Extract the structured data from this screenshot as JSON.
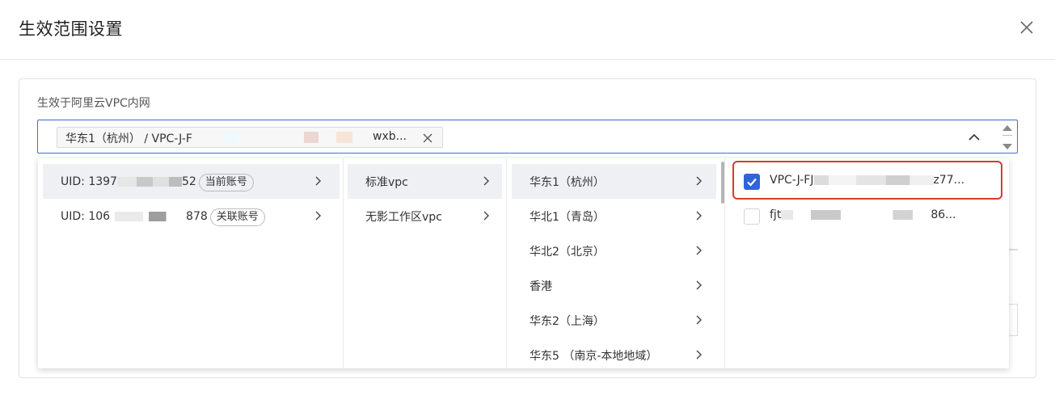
{
  "dialog": {
    "title": "生效范围设置",
    "close_icon": "close-icon"
  },
  "form": {
    "label": "生效于阿里云VPC内网",
    "selected_tag": {
      "text": "华东1（杭州） / VPC-J-F",
      "tail": "wxb..."
    }
  },
  "cascader": {
    "accounts": [
      {
        "uid_prefix": "UID: 1397",
        "uid_suffix": "52",
        "badge": "当前账号",
        "active": true
      },
      {
        "uid_prefix": "UID: 106",
        "uid_suffix": "878",
        "badge": "关联账号",
        "active": false
      }
    ],
    "vpc_types": [
      {
        "label": "标准vpc",
        "active": true
      },
      {
        "label": "无影工作区vpc",
        "active": false
      }
    ],
    "regions": [
      {
        "label": "华东1（杭州）",
        "active": true
      },
      {
        "label": "华北1（青岛）",
        "active": false
      },
      {
        "label": "华北2（北京）",
        "active": false
      },
      {
        "label": "香港",
        "active": false
      },
      {
        "label": "华东2（上海）",
        "active": false
      },
      {
        "label": "华东5 （南京-本地地域）",
        "active": false
      }
    ],
    "vpcs": [
      {
        "prefix": "VPC-J-FJ",
        "suffix": "z77...",
        "checked": true
      },
      {
        "prefix": "fjt",
        "suffix": "86...",
        "checked": false
      }
    ]
  },
  "colors": {
    "accent": "#2f65d8",
    "highlight_border": "#d93a2b",
    "active_bg": "#eef0f4"
  }
}
